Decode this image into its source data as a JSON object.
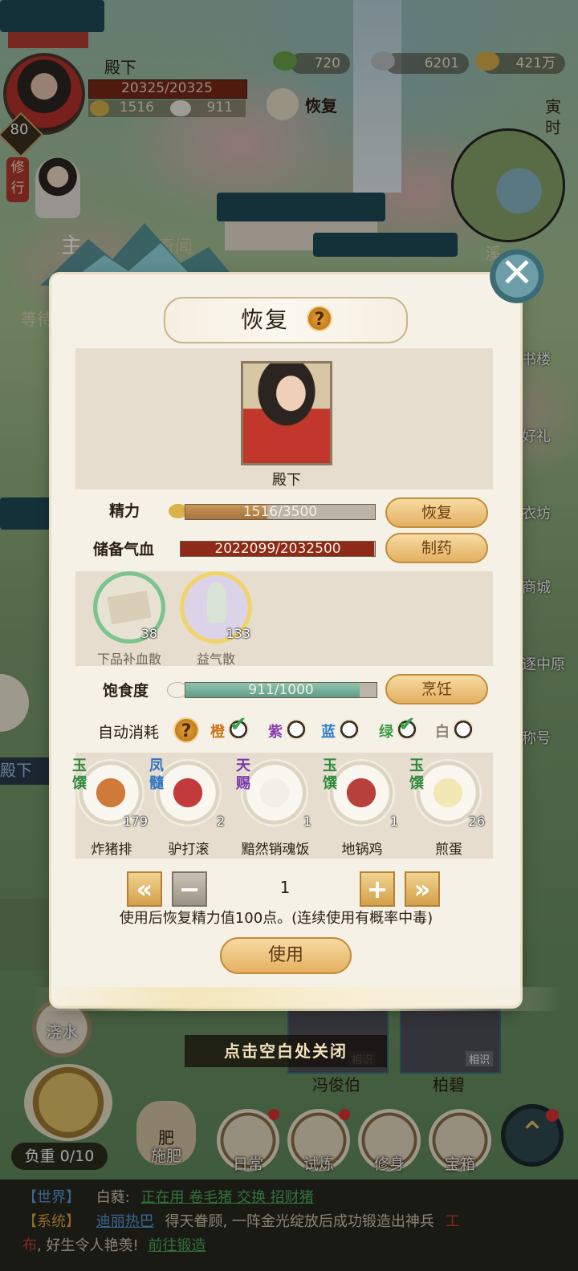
{
  "hud": {
    "player_name": "殿下",
    "hp": "20325/20325",
    "stamina": "1516",
    "food": "911",
    "level": "80",
    "currency_jade": "720",
    "currency_silver": "6201",
    "currency_coin": "421万",
    "restore_label": "恢复",
    "time_label": "寅时",
    "xiuxing_label": "修行"
  },
  "dialog": {
    "title": "恢复",
    "portrait_name": "殿下",
    "energy_label": "精力",
    "energy_value": "1516/3500",
    "energy_fraction": 0.433,
    "restore_button": "恢复",
    "blood_label": "储备气血",
    "blood_value": "2022099/2032500",
    "blood_fraction": 0.995,
    "medicine_button": "制药",
    "items": [
      {
        "name": "下品补血散",
        "count": "38",
        "ring": "#7bc48b"
      },
      {
        "name": "益气散",
        "count": "133",
        "ring": "#f0d36a"
      }
    ],
    "satiety_label": "饱食度",
    "satiety_value": "911/1000",
    "satiety_fraction": 0.911,
    "cook_button": "烹饪",
    "auto_label": "自动消耗",
    "auto_options": [
      {
        "label": "橙",
        "color": "#c9761a",
        "checked": true
      },
      {
        "label": "紫",
        "color": "#8a3fb0",
        "checked": false
      },
      {
        "label": "蓝",
        "color": "#2f7fc4",
        "checked": false
      },
      {
        "label": "绿",
        "color": "#3a9a44",
        "checked": true
      },
      {
        "label": "白",
        "color": "#8a8275",
        "checked": false
      }
    ],
    "foods": [
      {
        "tag": "玉馔",
        "tag_color": "#2e8a3c",
        "name": "炸猪排",
        "count": "179"
      },
      {
        "tag": "凤髓",
        "tag_color": "#2f74c0",
        "name": "驴打滚",
        "count": "2"
      },
      {
        "tag": "天赐",
        "tag_color": "#7a36b0",
        "name": "黯然销魂饭",
        "count": "1"
      },
      {
        "tag": "玉馔",
        "tag_color": "#2e8a3c",
        "name": "地锅鸡",
        "count": "1"
      },
      {
        "tag": "玉馔",
        "tag_color": "#2e8a3c",
        "name": "煎蛋",
        "count": "26"
      }
    ],
    "quantity": "1",
    "hint": "使用后恢复精力值100点。(连续使用有概率中毒)",
    "use_button": "使用",
    "tap_close": "点击空白处关闭"
  },
  "background": {
    "tab_main": "主",
    "tab_odd": "奇闻",
    "waiting": "等待",
    "dianxia_side": "殿下",
    "right_menu": [
      "书楼",
      "好礼",
      "衣坊",
      "商城",
      "逐中原",
      "称号"
    ],
    "weather": "溪",
    "characters": [
      "冯俊伯",
      "柏碧"
    ],
    "card_tag": "相识",
    "water_btn": "浇水"
  },
  "nav": {
    "load": "负重 0/10",
    "fertilize": "施肥",
    "fertilize_top": "肥",
    "items": [
      "日常",
      "试炼",
      "修身",
      "宝箱"
    ]
  },
  "chat": {
    "line1_channel": "【世界】",
    "line1_user": "白蕤:",
    "line1_links": "正在用 卷毛猪 交换 招财猪",
    "line2_channel": "【系统】",
    "line2_user": "迪丽热巴",
    "line2_text": "得天眷顾, 一阵金光绽放后成功锻造出神兵",
    "line2_item_a": "工",
    "line3_item_b": "布",
    "line3_text": ", 好生令人艳羡!",
    "line3_link": "前往锻造"
  }
}
